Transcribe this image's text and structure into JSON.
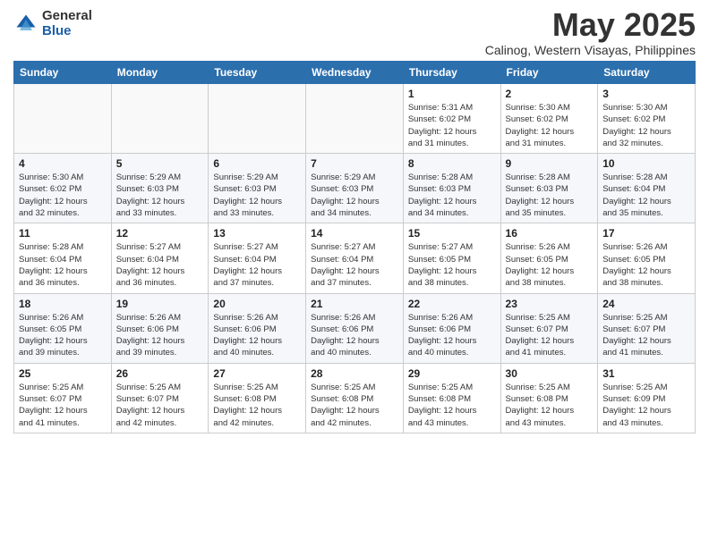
{
  "logo": {
    "general": "General",
    "blue": "Blue"
  },
  "title": {
    "month_year": "May 2025",
    "location": "Calinog, Western Visayas, Philippines"
  },
  "weekdays": [
    "Sunday",
    "Monday",
    "Tuesday",
    "Wednesday",
    "Thursday",
    "Friday",
    "Saturday"
  ],
  "weeks": [
    [
      {
        "day": "",
        "info": ""
      },
      {
        "day": "",
        "info": ""
      },
      {
        "day": "",
        "info": ""
      },
      {
        "day": "",
        "info": ""
      },
      {
        "day": "1",
        "info": "Sunrise: 5:31 AM\nSunset: 6:02 PM\nDaylight: 12 hours\nand 31 minutes."
      },
      {
        "day": "2",
        "info": "Sunrise: 5:30 AM\nSunset: 6:02 PM\nDaylight: 12 hours\nand 31 minutes."
      },
      {
        "day": "3",
        "info": "Sunrise: 5:30 AM\nSunset: 6:02 PM\nDaylight: 12 hours\nand 32 minutes."
      }
    ],
    [
      {
        "day": "4",
        "info": "Sunrise: 5:30 AM\nSunset: 6:02 PM\nDaylight: 12 hours\nand 32 minutes."
      },
      {
        "day": "5",
        "info": "Sunrise: 5:29 AM\nSunset: 6:03 PM\nDaylight: 12 hours\nand 33 minutes."
      },
      {
        "day": "6",
        "info": "Sunrise: 5:29 AM\nSunset: 6:03 PM\nDaylight: 12 hours\nand 33 minutes."
      },
      {
        "day": "7",
        "info": "Sunrise: 5:29 AM\nSunset: 6:03 PM\nDaylight: 12 hours\nand 34 minutes."
      },
      {
        "day": "8",
        "info": "Sunrise: 5:28 AM\nSunset: 6:03 PM\nDaylight: 12 hours\nand 34 minutes."
      },
      {
        "day": "9",
        "info": "Sunrise: 5:28 AM\nSunset: 6:03 PM\nDaylight: 12 hours\nand 35 minutes."
      },
      {
        "day": "10",
        "info": "Sunrise: 5:28 AM\nSunset: 6:04 PM\nDaylight: 12 hours\nand 35 minutes."
      }
    ],
    [
      {
        "day": "11",
        "info": "Sunrise: 5:28 AM\nSunset: 6:04 PM\nDaylight: 12 hours\nand 36 minutes."
      },
      {
        "day": "12",
        "info": "Sunrise: 5:27 AM\nSunset: 6:04 PM\nDaylight: 12 hours\nand 36 minutes."
      },
      {
        "day": "13",
        "info": "Sunrise: 5:27 AM\nSunset: 6:04 PM\nDaylight: 12 hours\nand 37 minutes."
      },
      {
        "day": "14",
        "info": "Sunrise: 5:27 AM\nSunset: 6:04 PM\nDaylight: 12 hours\nand 37 minutes."
      },
      {
        "day": "15",
        "info": "Sunrise: 5:27 AM\nSunset: 6:05 PM\nDaylight: 12 hours\nand 38 minutes."
      },
      {
        "day": "16",
        "info": "Sunrise: 5:26 AM\nSunset: 6:05 PM\nDaylight: 12 hours\nand 38 minutes."
      },
      {
        "day": "17",
        "info": "Sunrise: 5:26 AM\nSunset: 6:05 PM\nDaylight: 12 hours\nand 38 minutes."
      }
    ],
    [
      {
        "day": "18",
        "info": "Sunrise: 5:26 AM\nSunset: 6:05 PM\nDaylight: 12 hours\nand 39 minutes."
      },
      {
        "day": "19",
        "info": "Sunrise: 5:26 AM\nSunset: 6:06 PM\nDaylight: 12 hours\nand 39 minutes."
      },
      {
        "day": "20",
        "info": "Sunrise: 5:26 AM\nSunset: 6:06 PM\nDaylight: 12 hours\nand 40 minutes."
      },
      {
        "day": "21",
        "info": "Sunrise: 5:26 AM\nSunset: 6:06 PM\nDaylight: 12 hours\nand 40 minutes."
      },
      {
        "day": "22",
        "info": "Sunrise: 5:26 AM\nSunset: 6:06 PM\nDaylight: 12 hours\nand 40 minutes."
      },
      {
        "day": "23",
        "info": "Sunrise: 5:25 AM\nSunset: 6:07 PM\nDaylight: 12 hours\nand 41 minutes."
      },
      {
        "day": "24",
        "info": "Sunrise: 5:25 AM\nSunset: 6:07 PM\nDaylight: 12 hours\nand 41 minutes."
      }
    ],
    [
      {
        "day": "25",
        "info": "Sunrise: 5:25 AM\nSunset: 6:07 PM\nDaylight: 12 hours\nand 41 minutes."
      },
      {
        "day": "26",
        "info": "Sunrise: 5:25 AM\nSunset: 6:07 PM\nDaylight: 12 hours\nand 42 minutes."
      },
      {
        "day": "27",
        "info": "Sunrise: 5:25 AM\nSunset: 6:08 PM\nDaylight: 12 hours\nand 42 minutes."
      },
      {
        "day": "28",
        "info": "Sunrise: 5:25 AM\nSunset: 6:08 PM\nDaylight: 12 hours\nand 42 minutes."
      },
      {
        "day": "29",
        "info": "Sunrise: 5:25 AM\nSunset: 6:08 PM\nDaylight: 12 hours\nand 43 minutes."
      },
      {
        "day": "30",
        "info": "Sunrise: 5:25 AM\nSunset: 6:08 PM\nDaylight: 12 hours\nand 43 minutes."
      },
      {
        "day": "31",
        "info": "Sunrise: 5:25 AM\nSunset: 6:09 PM\nDaylight: 12 hours\nand 43 minutes."
      }
    ]
  ]
}
